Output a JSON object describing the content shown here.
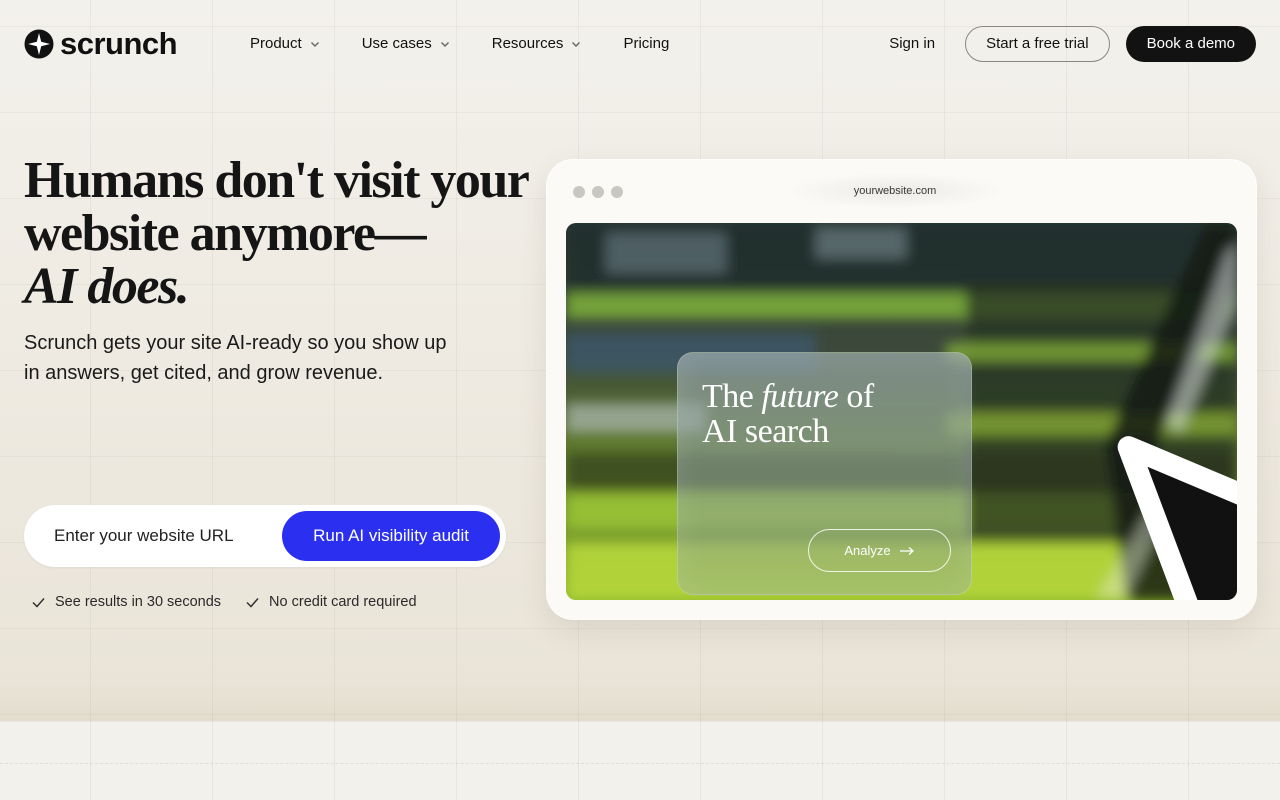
{
  "brand": {
    "name": "scrunch"
  },
  "nav": {
    "items": [
      {
        "label": "Product",
        "has_dropdown": true
      },
      {
        "label": "Use cases",
        "has_dropdown": true
      },
      {
        "label": "Resources",
        "has_dropdown": true
      },
      {
        "label": "Pricing",
        "has_dropdown": false
      }
    ],
    "sign_in": "Sign in",
    "trial_button": "Start a free trial",
    "demo_button": "Book a demo"
  },
  "hero": {
    "title_line1": "Humans don't visit your",
    "title_line2": "website anymore—",
    "title_line3": "AI does.",
    "subtitle": "Scrunch gets your site AI-ready so you show up in answers, get cited, and grow revenue.",
    "url_placeholder": "Enter your website URL",
    "url_value": "",
    "audit_button": "Run AI visibility audit",
    "checks": [
      "See results in 30 seconds",
      "No credit card required"
    ]
  },
  "mockup": {
    "url": "yourwebsite.com",
    "card_title_pre": "The ",
    "card_title_italic": "future",
    "card_title_post": " of",
    "card_title_line2": "AI search",
    "analyze_button": "Analyze"
  },
  "colors": {
    "accent": "#2a2ff0",
    "dark_button": "#121212",
    "background": "#f3f1ec"
  },
  "icons": {
    "logo": "star-burst-icon",
    "dropdown": "chevron-down-icon",
    "check": "check-icon",
    "arrow": "arrow-right-icon",
    "cursor": "mouse-pointer-icon"
  }
}
